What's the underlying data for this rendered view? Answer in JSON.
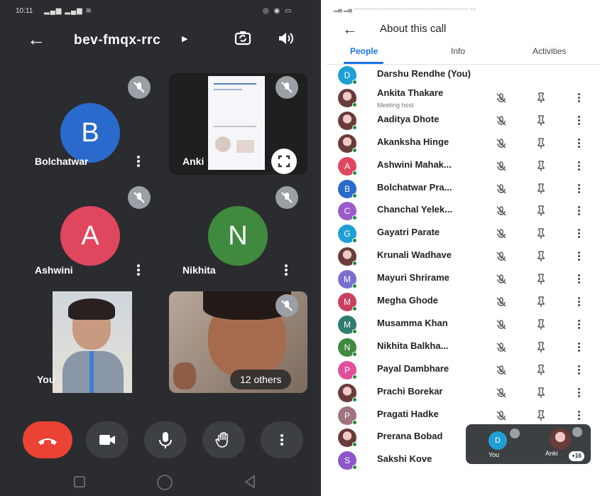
{
  "left": {
    "status_time": "10:11",
    "meeting_code": "bev-fmqx-rrc",
    "tiles": {
      "bolchatwar": {
        "initial": "B",
        "name": "Bolchatwar",
        "color": "#2a6acc"
      },
      "ankita": {
        "name": "Anki"
      },
      "ashwini": {
        "initial": "A",
        "name": "Ashwini",
        "color": "#e0465e"
      },
      "nikhita": {
        "initial": "N",
        "name": "Nikhita",
        "color": "#3f8a3f"
      },
      "you": {
        "name": "You"
      },
      "others": {
        "label": "12 others"
      }
    },
    "end_call_color": "#ea4335"
  },
  "right": {
    "title": "About this call",
    "tabs": [
      "People",
      "Info",
      "Activities"
    ],
    "people": [
      {
        "name": "Darshu Rendhe (You)",
        "initial": "D",
        "color": "#1f9fd6",
        "photo": false,
        "controls": false
      },
      {
        "name": "Ankita Thakare",
        "sub": "Meeting host",
        "photo": true,
        "controls": true
      },
      {
        "name": "Aaditya Dhote",
        "photo": true,
        "controls": true
      },
      {
        "name": "Akanksha Hinge",
        "photo": true,
        "controls": true
      },
      {
        "name": "Ashwini Mahak...",
        "initial": "A",
        "color": "#e0465e",
        "photo": false,
        "controls": true
      },
      {
        "name": "Bolchatwar Pra...",
        "initial": "B",
        "color": "#2a6acc",
        "photo": false,
        "controls": true
      },
      {
        "name": "Chanchal Yelek...",
        "initial": "C",
        "color": "#9b5cc9",
        "photo": false,
        "controls": true
      },
      {
        "name": "Gayatri Parate",
        "initial": "G",
        "color": "#1f9fd6",
        "photo": false,
        "controls": true
      },
      {
        "name": "Krunali Wadhave",
        "photo": true,
        "controls": true
      },
      {
        "name": "Mayuri Shrirame",
        "initial": "M",
        "color": "#7a6fd0",
        "photo": false,
        "controls": true
      },
      {
        "name": "Megha Ghode",
        "initial": "M",
        "color": "#c9405e",
        "photo": false,
        "controls": true
      },
      {
        "name": "Musamma Khan",
        "initial": "M",
        "color": "#2f7d6e",
        "photo": false,
        "controls": true
      },
      {
        "name": "Nikhita Balkha...",
        "initial": "N",
        "color": "#3f8a3f",
        "photo": false,
        "controls": true
      },
      {
        "name": "Payal Dambhare",
        "initial": "P",
        "color": "#e04f9b",
        "photo": false,
        "controls": true
      },
      {
        "name": "Prachi Borekar",
        "photo": true,
        "controls": true
      },
      {
        "name": "Pragati Hadke",
        "initial": "P",
        "color": "#a0737e",
        "photo": false,
        "controls": true
      },
      {
        "name": "Prerana Bobad",
        "photo": true,
        "controls": false
      },
      {
        "name": "Sakshi Kove",
        "initial": "S",
        "color": "#8e56c9",
        "photo": false,
        "controls": false
      }
    ],
    "pip": {
      "you_label": "You",
      "you_initial": "D",
      "other_label": "Anki",
      "count": "+16"
    }
  }
}
